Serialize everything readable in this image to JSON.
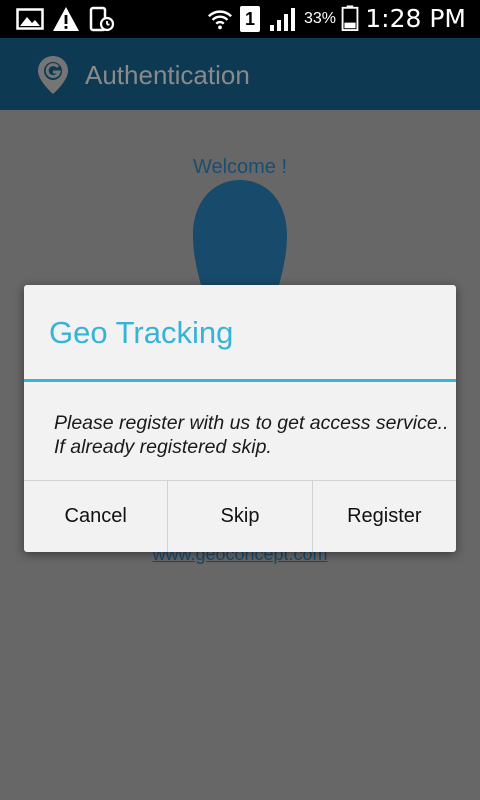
{
  "status_bar": {
    "battery_percent": "33%",
    "time": "1:28 PM",
    "sim_number": "1",
    "icons": [
      "image-icon",
      "warning-icon",
      "usage-icon",
      "wifi-icon",
      "sim-icon",
      "signal-icon",
      "battery-icon"
    ]
  },
  "app_bar": {
    "title": "Authentication",
    "logo_letter": "G"
  },
  "content": {
    "welcome": "Welcome !",
    "footer_link": "www.geoconcept.com"
  },
  "dialog": {
    "title": "Geo Tracking",
    "message_line1": "Please register with us to get access service..",
    "message_line2": "If already registered skip.",
    "buttons": {
      "cancel": "Cancel",
      "skip": "Skip",
      "register": "Register"
    }
  },
  "colors": {
    "accent": "#36b3d8",
    "app_bar": "#0d3a52",
    "scrim": "#676767"
  }
}
